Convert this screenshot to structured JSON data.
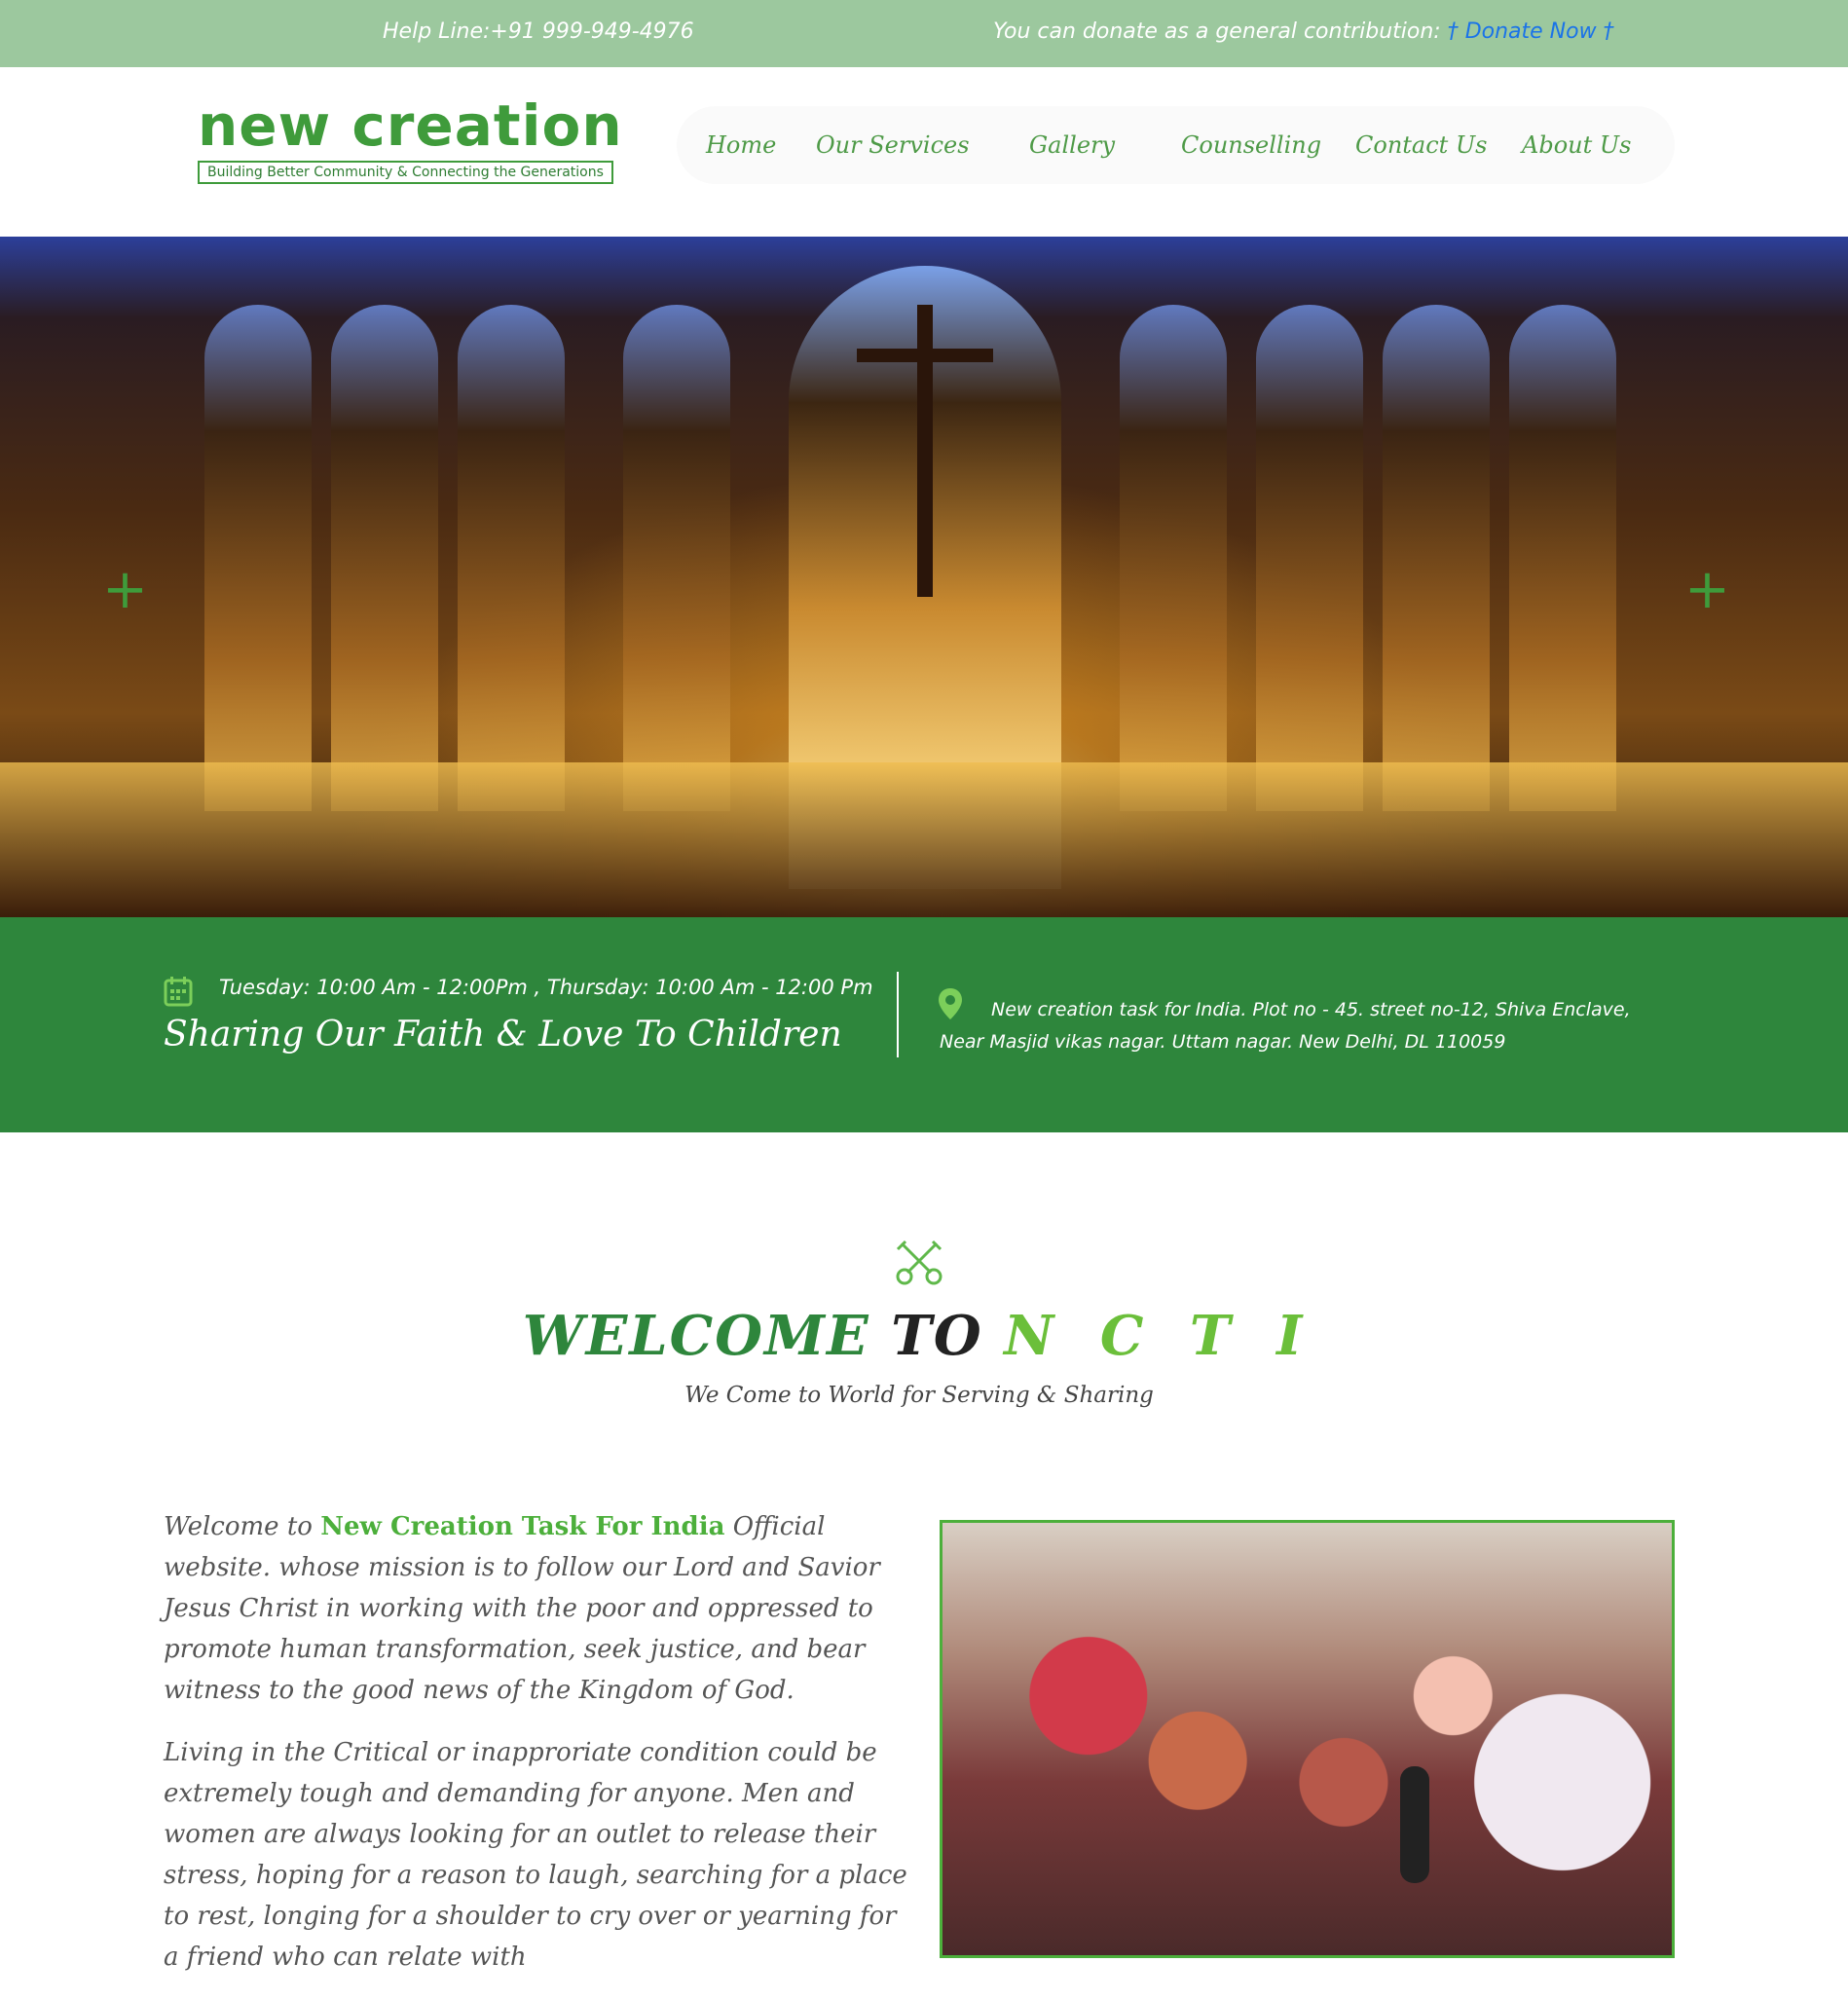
{
  "topbar": {
    "helpline": "Help Line:+91 999-949-4976",
    "donate_text": "You can donate as a general contribution:",
    "donate_link": "† Donate Now †"
  },
  "logo": {
    "name": "new creation",
    "tagline": "Building Better Community & Connecting the Generations"
  },
  "nav": {
    "items": [
      {
        "label": "Home"
      },
      {
        "label": "Our Services"
      },
      {
        "label": "Gallery"
      },
      {
        "label": "Counselling"
      },
      {
        "label": "Contact Us"
      },
      {
        "label": "About Us"
      }
    ]
  },
  "hero": {
    "prev_icon": "plus-icon",
    "next_icon": "plus-icon"
  },
  "info": {
    "hours": "Tuesday: 10:00 Am - 12:00Pm , Thursday: 10:00 Am - 12:00 Pm",
    "tagline": "Sharing Our Faith & Love To Children",
    "address_line1": "New creation task for India. Plot no - 45. street no-12, Shiva Enclave,",
    "address_line2": "Near Masjid vikas nagar. Uttam nagar. New Delhi, DL 110059"
  },
  "welcome": {
    "title_part1": "WELCOME",
    "title_part2": "TO",
    "title_part3": "N C T I",
    "subtitle": "We Come to World for Serving & Sharing",
    "para1_prefix": "Welcome to",
    "para1_highlight": "New Creation Task For India",
    "para1_rest": "Official website. whose mission is to follow our Lord and Savior Jesus Christ in working with the poor and oppressed to promote human transformation, seek justice, and bear witness to the good news of the Kingdom of God.",
    "para2": "Living in the Critical or inapproriate condition could be extremely tough and demanding for anyone. Men and women are always looking for an outlet to release their stress, hoping for a reason to laugh, searching for a place to rest, longing for a shoulder to cry over or yearning for a friend who can relate with"
  },
  "colors": {
    "topbar": "#9cc89e",
    "brand_green": "#3f9b3b",
    "infobar": "#2e863c",
    "link_blue": "#1a73e8"
  }
}
